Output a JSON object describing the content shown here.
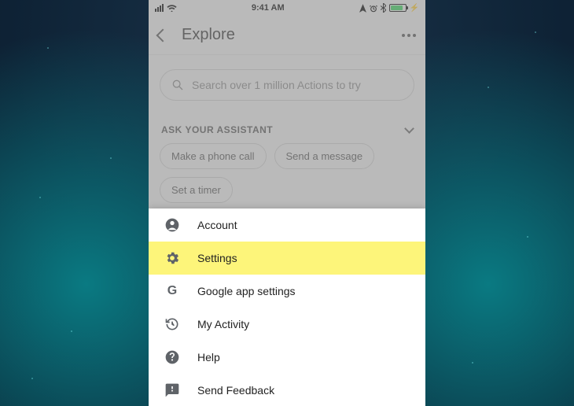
{
  "status": {
    "carrier_signal": "signal-4",
    "wifi": "wifi",
    "time": "9:41 AM",
    "icons": [
      "location",
      "alarm",
      "bluetooth"
    ],
    "battery_charging": true
  },
  "nav": {
    "title": "Explore"
  },
  "search": {
    "placeholder": "Search over 1 million Actions to try"
  },
  "section": {
    "heading": "ASK YOUR ASSISTANT"
  },
  "chips": {
    "a": "Make a phone call",
    "b": "Send a message",
    "c": "Set a timer"
  },
  "sheet": {
    "account": "Account",
    "settings": "Settings",
    "google_app": "Google app settings",
    "activity": "My Activity",
    "help": "Help",
    "feedback": "Send Feedback"
  },
  "highlight_key": "settings"
}
